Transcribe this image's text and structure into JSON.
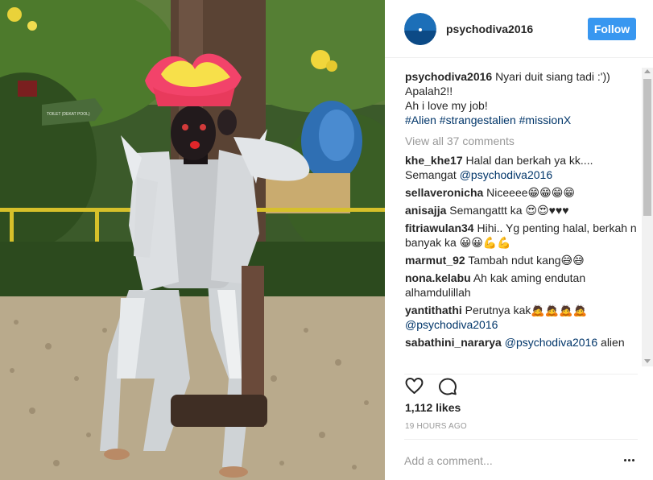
{
  "post": {
    "username": "psychodiva2016",
    "follow_label": "Follow",
    "caption": {
      "username": "psychodiva2016",
      "line1": "Nyari duit siang tadi :'))",
      "line2": "Apalah2!!",
      "line3": "Ah i love my job!",
      "hashtags": "#Alien #strangestalien #missionX"
    },
    "view_all_comments": "View all 37 comments",
    "comments": [
      {
        "username": "khe_khe17",
        "text": "Halal dan berkah ya kk.... Semangat ",
        "mention": "@psychodiva2016",
        "after": ""
      },
      {
        "username": "sellaveronicha",
        "text": "Niceeee😁😁😁😁",
        "mention": "",
        "after": ""
      },
      {
        "username": "anisajja",
        "text": "Semangattt ka 😍😍♥♥♥",
        "mention": "",
        "after": ""
      },
      {
        "username": "fitriawulan34",
        "text": "Hihi.. Yg penting halal, berkah n banyak ka 😀😀💪💪",
        "mention": "",
        "after": ""
      },
      {
        "username": "marmut_92",
        "text": "Tambah ndut kang😅😅",
        "mention": "",
        "after": ""
      },
      {
        "username": "nona.kelabu",
        "text": "Ah kak aming endutan alhamdulillah",
        "mention": "",
        "after": ""
      },
      {
        "username": "yantithathi",
        "text": "Perutnya kak🙇🙇🙇🙇 ",
        "mention": "@psychodiva2016",
        "after": ""
      },
      {
        "username": "sabathini_nararya",
        "text": "",
        "mention": "@psychodiva2016",
        "after": " alien"
      }
    ],
    "likes": "1,112 likes",
    "timestamp": "19 HOURS AGO",
    "add_comment_placeholder": "Add a comment...",
    "icons": {
      "like": "heart-icon",
      "comment": "comment-bubble-icon",
      "more": "more-options-icon"
    },
    "colors": {
      "follow_button": "#3897f0",
      "hashtag": "#003569",
      "muted": "#999999"
    },
    "photo": {
      "sign_text": "TOILET (DEKAT POOL)"
    }
  }
}
